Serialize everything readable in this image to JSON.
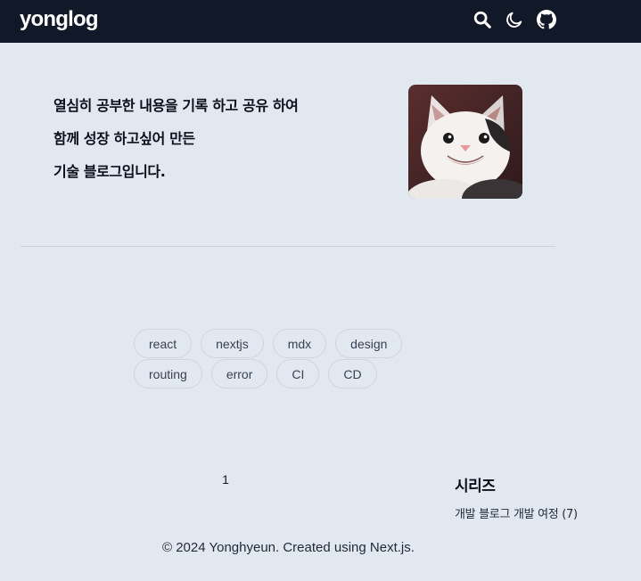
{
  "header": {
    "logo": "yonglog",
    "icons": [
      "search-icon",
      "moon-icon",
      "github-icon"
    ],
    "background_color": "#111827"
  },
  "intro": {
    "lines": [
      "열심히 공부한 내용을 기록 하고 공유 하여",
      "함께 성장 하고싶어 만든",
      "기술 블로그입니다."
    ]
  },
  "tags": [
    "react",
    "nextjs",
    "mdx",
    "design",
    "routing",
    "error",
    "CI",
    "CD"
  ],
  "pagination": {
    "current_page": "1"
  },
  "series": {
    "heading": "시리즈",
    "items": [
      "개발 블로그 개발 여정 (7)"
    ]
  },
  "footer": {
    "text": "© 2024 Yonghyeun. Created using Next.js."
  }
}
